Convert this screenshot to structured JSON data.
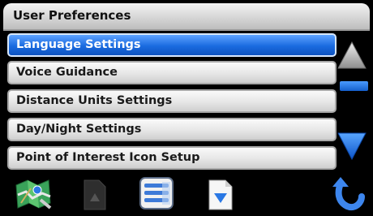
{
  "title_bar": {
    "title": "User Preferences"
  },
  "menu": {
    "items": [
      {
        "label": "Language Settings",
        "selected": true
      },
      {
        "label": "Voice Guidance",
        "selected": false
      },
      {
        "label": "Distance Units Settings",
        "selected": false
      },
      {
        "label": "Day/Night Settings",
        "selected": false
      },
      {
        "label": "Point of Interest Icon Setup",
        "selected": false
      }
    ]
  },
  "icons": {
    "scroll_up": "triangle-up-icon",
    "scroll_down": "triangle-down-icon",
    "map": "map-icon",
    "page": "page-icon",
    "list": "list-icon",
    "document_down": "document-down-icon",
    "back": "back-arrow-icon"
  },
  "colors": {
    "selected_accent": "#1a6be0",
    "scroll_accent": "#1b6fe0"
  }
}
